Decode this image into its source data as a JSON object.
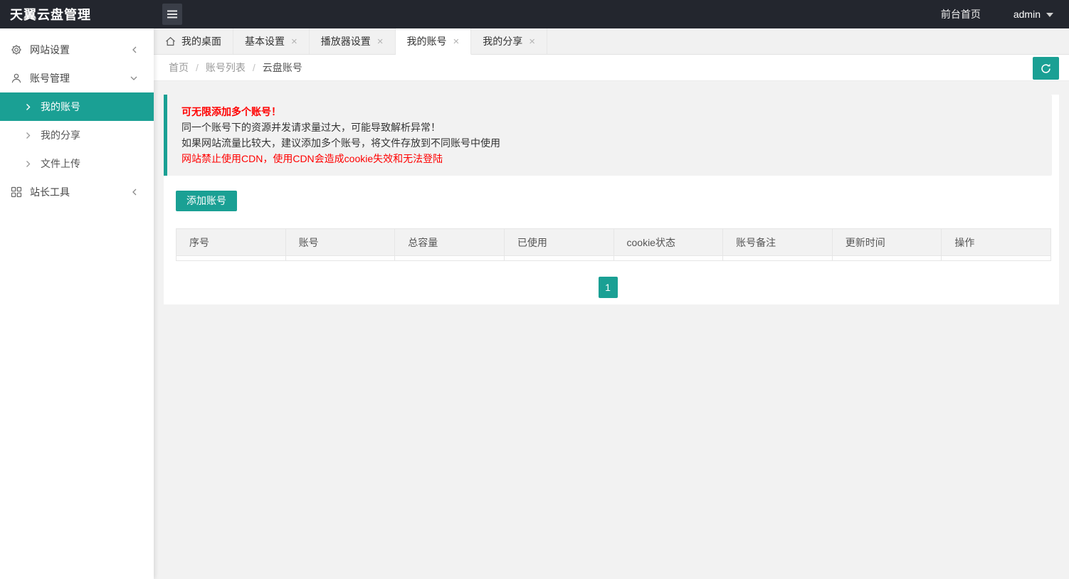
{
  "app": {
    "title": "天翼云盘管理"
  },
  "header": {
    "front_link": "前台首页",
    "username": "admin"
  },
  "sidebar": {
    "items": [
      {
        "label": "网站设置"
      },
      {
        "label": "账号管理"
      },
      {
        "label": "站长工具"
      }
    ],
    "subitems": [
      {
        "label": "我的账号"
      },
      {
        "label": "我的分享"
      },
      {
        "label": "文件上传"
      }
    ]
  },
  "tabs": [
    {
      "label": "我的桌面"
    },
    {
      "label": "基本设置"
    },
    {
      "label": "播放器设置"
    },
    {
      "label": "我的账号"
    },
    {
      "label": "我的分享"
    }
  ],
  "breadcrumb": {
    "home": "首页",
    "list": "账号列表",
    "current": "云盘账号",
    "separator": "/"
  },
  "notice": {
    "line1": "可无限添加多个账号！",
    "line2": "同一个账号下的资源并发请求量过大，可能导致解析异常！",
    "line3": "如果网站流量比较大，建议添加多个账号，将文件存放到不同账号中使用",
    "line4": "网站禁止使用CDN，使用CDN会造成cookie失效和无法登陆"
  },
  "toolbar": {
    "add_button": "添加账号"
  },
  "table": {
    "headers": [
      "序号",
      "账号",
      "总容量",
      "已使用",
      "cookie状态",
      "账号备注",
      "更新时间",
      "操作"
    ],
    "rows": []
  },
  "pagination": {
    "page": "1"
  },
  "icons": {
    "close": "×"
  },
  "colors": {
    "accent": "#1aa094",
    "header_bg": "#23262e",
    "danger": "#ff0000"
  }
}
